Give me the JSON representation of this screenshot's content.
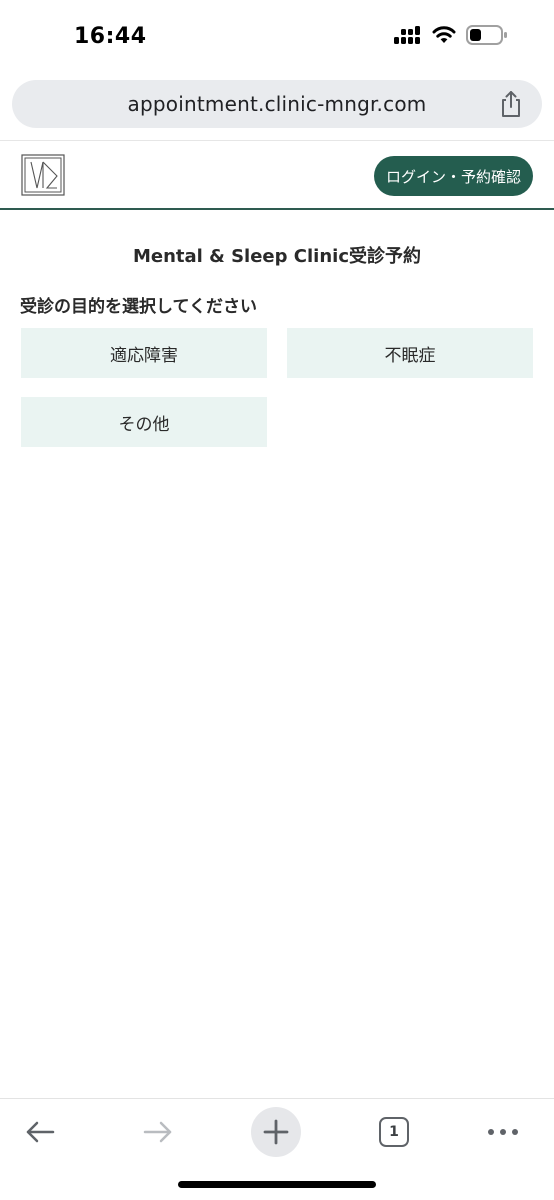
{
  "status_bar": {
    "time": "16:44",
    "icons": [
      "signal-icon",
      "wifi-icon",
      "battery-icon"
    ]
  },
  "browser": {
    "url": "appointment.clinic-mngr.com",
    "share_icon": "share-icon",
    "tab_count": "1"
  },
  "header": {
    "logo_icon": "clinic-logo-icon",
    "login_label": "ログイン・予約確認"
  },
  "main": {
    "title": "Mental & Sleep Clinic受診予約",
    "section_label": "受診の目的を選択してください",
    "options": [
      {
        "label": "適応障害"
      },
      {
        "label": "不眠症"
      },
      {
        "label": "その他"
      }
    ]
  },
  "colors": {
    "brand_green": "#245d4f",
    "option_bg": "#eaf4f2",
    "url_bar_bg": "#e9ebee"
  }
}
